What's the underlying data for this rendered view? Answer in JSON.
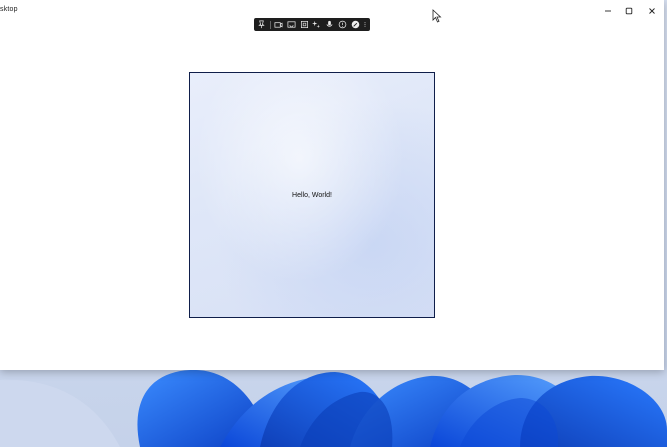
{
  "window": {
    "title": "sktop"
  },
  "canvas": {
    "text": "Hello, World!"
  },
  "toolbar": {
    "items": [
      "pin-icon",
      "camera-icon",
      "cast-icon",
      "region-select-icon",
      "sparkle-icon",
      "microphone-icon",
      "help-circle-icon",
      "edit-pen-icon",
      "more-icon"
    ]
  },
  "colors": {
    "window_bg": "#ffffff",
    "toolbar_bg": "#1e1e1e",
    "canvas_border": "#0f1e4a",
    "wallpaper_blue": "#1a5fe0"
  }
}
